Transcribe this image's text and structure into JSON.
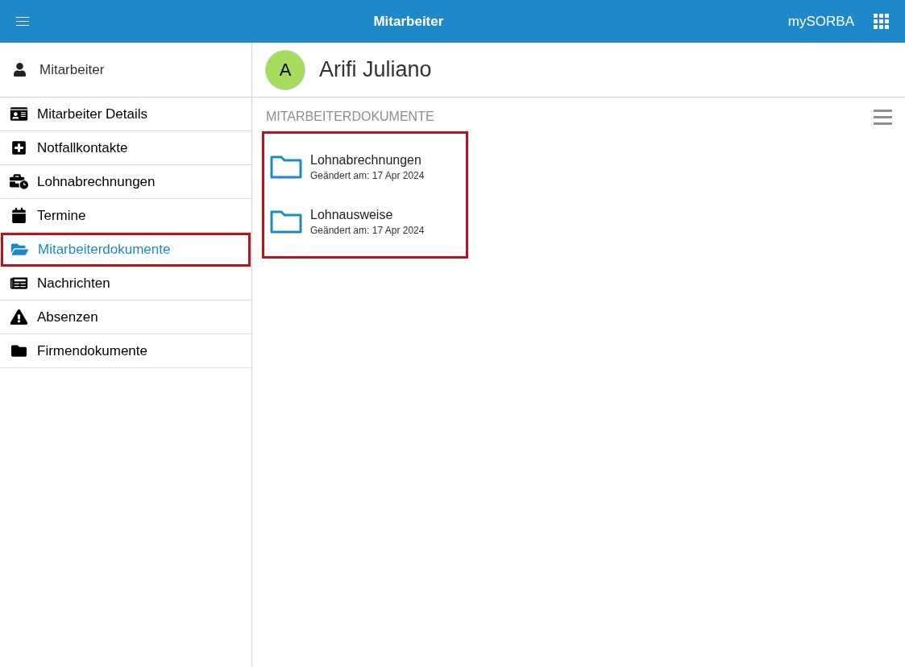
{
  "top_bar": {
    "title": "Mitarbeiter",
    "brand": "mySORBA"
  },
  "sidebar": {
    "header": "Mitarbeiter",
    "items": [
      {
        "label": "Mitarbeiter Details",
        "kind": "idcard",
        "selected": false,
        "highlighted": false
      },
      {
        "label": "Notfallkontakte",
        "kind": "plus",
        "selected": false,
        "highlighted": false
      },
      {
        "label": "Lohnabrechnungen",
        "kind": "briefcase",
        "selected": false,
        "highlighted": false
      },
      {
        "label": "Termine",
        "kind": "calendar",
        "selected": false,
        "highlighted": false
      },
      {
        "label": "Mitarbeiterdokumente",
        "kind": "folderopen",
        "selected": true,
        "highlighted": true
      },
      {
        "label": "Nachrichten",
        "kind": "news",
        "selected": false,
        "highlighted": false
      },
      {
        "label": "Absenzen",
        "kind": "warning",
        "selected": false,
        "highlighted": false
      },
      {
        "label": "Firmendokumente",
        "kind": "folder",
        "selected": false,
        "highlighted": false
      }
    ]
  },
  "employee": {
    "initial": "A",
    "name": "Arifi Juliano"
  },
  "documents": {
    "heading": "MITARBEITERDOKUMENTE",
    "highlighted": true,
    "folders": [
      {
        "name": "Lohnabrechnungen",
        "modified": "Geändert am: 17 Apr 2024"
      },
      {
        "name": "Lohnausweise",
        "modified": "Geändert am: 17 Apr 2024"
      }
    ]
  }
}
